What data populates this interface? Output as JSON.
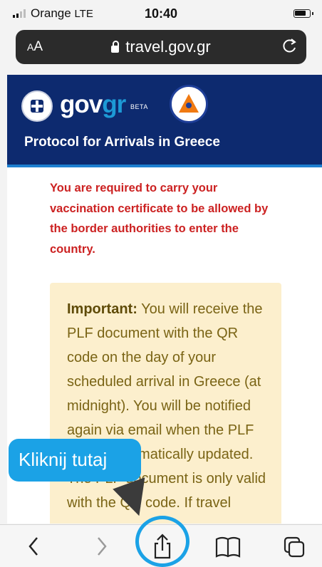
{
  "status_bar": {
    "carrier": "Orange",
    "network": "LTE",
    "time": "10:40"
  },
  "address_bar": {
    "text_size_label_big": "A",
    "text_size_label_small": "A",
    "domain": "travel.gov.gr"
  },
  "header": {
    "logo_gov": "gov",
    "logo_gr": "gr",
    "beta": "BETA",
    "title": "Protocol for Arrivals in Greece"
  },
  "warning": "You are required to carry your vaccination certificate to be allowed by the border authorities to enter the country.",
  "notice": {
    "label": "Important:",
    "text": " You will receive the PLF document with the QR code on the day of your scheduled arrival in Greece (at midnight). You will be notified again via email when the PLF will be automatically updated. The PLF document is only valid with the QR code. If travel"
  },
  "callout": "Kliknij tutaj",
  "toolbar": [
    "back-icon",
    "forward-icon",
    "share-icon",
    "bookmarks-icon",
    "tabs-icon"
  ]
}
